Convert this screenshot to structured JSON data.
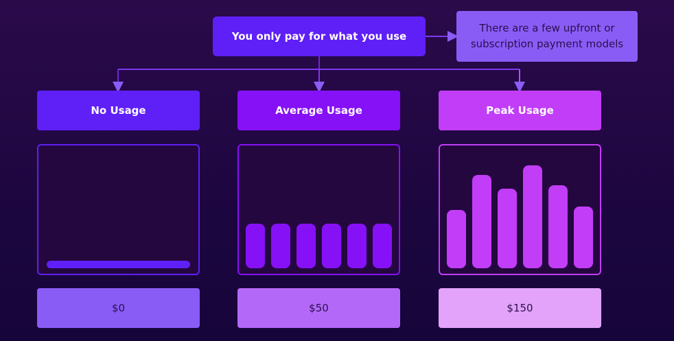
{
  "root": {
    "label": "You only pay for what you use"
  },
  "note": {
    "line1": "There are a few upfront or",
    "line2": "subscription payment models"
  },
  "columns": [
    {
      "title": "No Usage",
      "price": "$0",
      "color": "#5f1ff7",
      "usage_levels": [
        0.05
      ]
    },
    {
      "title": "Average Usage",
      "price": "$50",
      "color": "#8611f7",
      "usage_levels": [
        0.38,
        0.38,
        0.38,
        0.38,
        0.38,
        0.38
      ]
    },
    {
      "title": "Peak Usage",
      "price": "$150",
      "color": "#c23df7",
      "usage_levels": [
        0.5,
        0.8,
        0.68,
        0.88,
        0.71,
        0.53
      ]
    }
  ]
}
